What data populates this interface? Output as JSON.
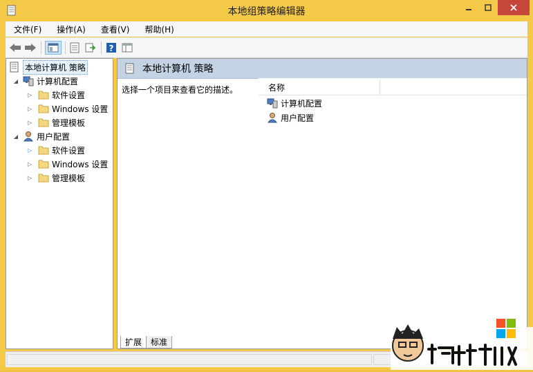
{
  "window": {
    "title": "本地组策略编辑器"
  },
  "menubar": {
    "items": [
      {
        "label": "文件(F)"
      },
      {
        "label": "操作(A)"
      },
      {
        "label": "查看(V)"
      },
      {
        "label": "帮助(H)"
      }
    ]
  },
  "toolbar": {
    "icons": [
      "back-arrow-icon",
      "forward-arrow-icon",
      "show-hide-tree-icon",
      "properties-icon",
      "export-list-icon",
      "help-icon",
      "extended-view-icon"
    ]
  },
  "tree": {
    "root": "本地计算机 策略",
    "computer": {
      "label": "计算机配置",
      "children": [
        "软件设置",
        "Windows 设置",
        "管理模板"
      ]
    },
    "user": {
      "label": "用户配置",
      "children": [
        "软件设置",
        "Windows 设置",
        "管理模板"
      ]
    }
  },
  "right": {
    "header": "本地计算机 策略",
    "description": "选择一个项目来查看它的描述。",
    "column_name": "名称",
    "rows": [
      "计算机配置",
      "用户配置"
    ],
    "tabs": [
      "扩展",
      "标准"
    ]
  },
  "colors": {
    "frame": "#f4c948",
    "close": "#c7463b",
    "header": "#c4d3e4"
  }
}
